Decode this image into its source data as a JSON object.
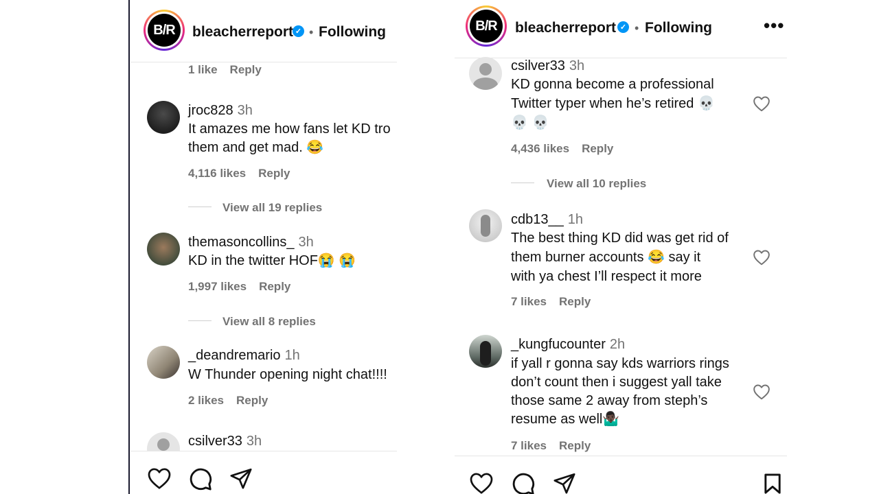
{
  "brand": {
    "logo_text": "B/R",
    "handle": "bleacherreport",
    "verified_mark": "✓",
    "separator": "•",
    "follow_state": "Following",
    "more": "•••"
  },
  "left_panel": {
    "prev_meta": {
      "likes": "1 like",
      "reply": "Reply"
    },
    "comments": [
      {
        "username": "jroc828",
        "time": "3h",
        "lines": [
          "It amazes me how fans let KD tro",
          "them and get mad. 😂"
        ],
        "likes": "4,116 likes",
        "reply": "Reply",
        "view_replies": "View all 19 replies",
        "avatar": "dark-portrait"
      },
      {
        "username": "themasoncollins_",
        "time": "3h",
        "lines": [
          "KD in the twitter HOF😭 😭"
        ],
        "likes": "1,997 likes",
        "reply": "Reply",
        "view_replies": "View all 8 replies",
        "avatar": "selfie-portrait"
      },
      {
        "username": "_deandremario",
        "time": "1h",
        "lines": [
          "W Thunder opening night chat!!!!"
        ],
        "likes": "2 likes",
        "reply": "Reply",
        "avatar": "room-photo"
      },
      {
        "username": "csilver33",
        "time": "3h",
        "avatar": "default-avatar"
      }
    ]
  },
  "right_panel": {
    "comments": [
      {
        "username": "csilver33",
        "time": "3h",
        "lines": [
          "KD gonna become a professional",
          "Twitter typer when he’s retired 💀",
          "💀 💀"
        ],
        "likes": "4,436 likes",
        "reply": "Reply",
        "view_replies": "View all 10 replies",
        "avatar": "default-avatar"
      },
      {
        "username": "cdb13__",
        "time": "1h",
        "lines": [
          "The best thing KD did was get rid of",
          "them burner accounts 😂 say it",
          "with ya chest I’ll respect it more"
        ],
        "likes": "7 likes",
        "reply": "Reply",
        "avatar": "light-photo"
      },
      {
        "username": "_kungfucounter",
        "time": "2h",
        "lines": [
          "if yall r gonna say kds warriors rings",
          "don’t count then i suggest yall take",
          "those same 2 away from steph’s",
          "resume as well🤷🏿‍♂️"
        ],
        "likes": "7 likes",
        "reply": "Reply",
        "avatar": "outdoor-photo"
      }
    ]
  },
  "icons": {
    "like": "heart-icon",
    "comment": "comment-icon",
    "share": "send-icon",
    "save": "bookmark-icon"
  }
}
